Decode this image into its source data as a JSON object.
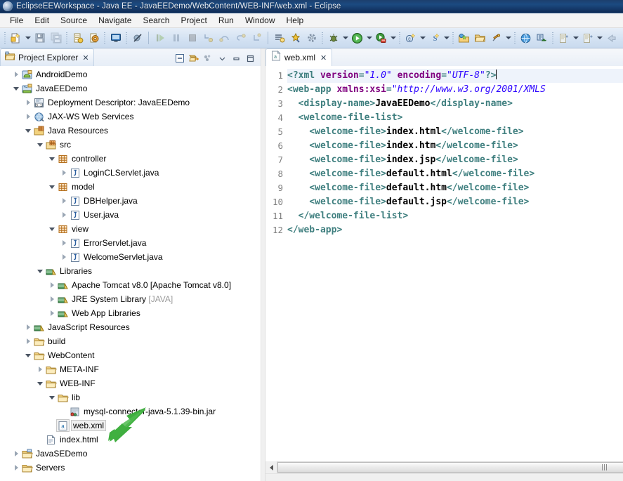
{
  "window": {
    "title": "EclipseEEWorkspace - Java EE - JavaEEDemo/WebContent/WEB-INF/web.xml - Eclipse",
    "app_icon": "eclipse-icon"
  },
  "menubar": {
    "items": [
      "File",
      "Edit",
      "Source",
      "Navigate",
      "Search",
      "Project",
      "Run",
      "Window",
      "Help"
    ]
  },
  "toolbar": {
    "groups": [
      {
        "buttons": [
          {
            "name": "new-wizard-button",
            "icon": "new-file-icon",
            "dropdown": true
          },
          {
            "name": "save-button",
            "icon": "save-icon",
            "dropdown": false
          },
          {
            "name": "save-all-button",
            "icon": "save-all-icon",
            "dropdown": false
          }
        ]
      },
      {
        "buttons": [
          {
            "name": "new-jsp-button",
            "icon": "jsp-file-icon",
            "dropdown": false
          },
          {
            "name": "new-servlet-button",
            "icon": "servlet-icon",
            "dropdown": false
          }
        ]
      },
      {
        "buttons": [
          {
            "name": "console-button",
            "icon": "console-icon",
            "dropdown": false
          }
        ]
      },
      {
        "buttons": [
          {
            "name": "skip-breakpoints-button",
            "icon": "skip-breakpoints-icon",
            "dropdown": false
          }
        ]
      },
      {
        "buttons": [
          {
            "name": "resume-button",
            "icon": "resume-icon",
            "dropdown": false
          },
          {
            "name": "suspend-button",
            "icon": "suspend-icon",
            "dropdown": false
          },
          {
            "name": "terminate-button",
            "icon": "terminate-icon",
            "dropdown": false
          },
          {
            "name": "step-into-button",
            "icon": "step-into-icon",
            "dropdown": false
          },
          {
            "name": "step-over-button",
            "icon": "step-over-icon",
            "dropdown": false
          },
          {
            "name": "step-return-button",
            "icon": "step-return-icon",
            "dropdown": false
          },
          {
            "name": "drop-to-frame-button",
            "icon": "drop-to-frame-icon",
            "dropdown": false
          }
        ]
      },
      {
        "buttons": [
          {
            "name": "open-type-button",
            "icon": "open-type-icon",
            "dropdown": false
          },
          {
            "name": "open-task-button",
            "icon": "open-task-icon",
            "dropdown": false
          },
          {
            "name": "build-all-button",
            "icon": "build-all-icon",
            "dropdown": false
          }
        ]
      },
      {
        "buttons": [
          {
            "name": "debug-button",
            "icon": "debug-icon",
            "dropdown": true
          },
          {
            "name": "run-button",
            "icon": "run-icon",
            "dropdown": true
          },
          {
            "name": "run-as-server-button",
            "icon": "run-server-icon",
            "dropdown": true
          }
        ]
      },
      {
        "buttons": [
          {
            "name": "new-java-class-button",
            "icon": "new-class-icon",
            "dropdown": true
          },
          {
            "name": "new-annotation-button",
            "icon": "new-annotation-icon",
            "dropdown": true
          }
        ]
      },
      {
        "buttons": [
          {
            "name": "open-perspective-button",
            "icon": "open-perspective-icon",
            "dropdown": false
          },
          {
            "name": "open-folder-button",
            "icon": "open-folder-icon",
            "dropdown": false
          },
          {
            "name": "search-button",
            "icon": "pin-icon",
            "dropdown": true
          }
        ]
      },
      {
        "buttons": [
          {
            "name": "web-browser-button",
            "icon": "globe-icon",
            "dropdown": false
          },
          {
            "name": "link-wizard-button",
            "icon": "link-wizard-icon",
            "dropdown": false
          }
        ]
      },
      {
        "buttons": [
          {
            "name": "previous-annotation-button",
            "icon": "prev-annotation-icon",
            "dropdown": true
          },
          {
            "name": "next-annotation-button",
            "icon": "next-annotation-icon",
            "dropdown": true
          },
          {
            "name": "back-button",
            "icon": "back-arrow-icon",
            "dropdown": false
          }
        ]
      }
    ]
  },
  "project_explorer": {
    "tab_label": "Project Explorer",
    "tab_icon": "project-explorer-icon",
    "tab_close": "✕",
    "tools": [
      {
        "name": "collapse-all-button",
        "icon": "collapse-all-icon"
      },
      {
        "name": "link-with-editor-button",
        "icon": "link-editor-icon"
      },
      {
        "name": "view-menu-button",
        "icon": "view-menu-icon"
      },
      {
        "name": "minimize-view-button",
        "icon": "minimize-icon"
      },
      {
        "name": "maximize-view-button",
        "icon": "maximize-icon"
      }
    ],
    "tree": [
      {
        "label": "AndroidDemo",
        "depth": 0,
        "twisty": "collapsed",
        "icon": "android-project-icon",
        "selected": false
      },
      {
        "label": "JavaEEDemo",
        "depth": 0,
        "twisty": "expanded",
        "icon": "javaee-project-icon",
        "selected": false
      },
      {
        "label": "Deployment Descriptor: JavaEEDemo",
        "depth": 1,
        "twisty": "collapsed",
        "icon": "deployment-descriptor-icon",
        "selected": false
      },
      {
        "label": "JAX-WS Web Services",
        "depth": 1,
        "twisty": "collapsed",
        "icon": "web-services-icon",
        "selected": false
      },
      {
        "label": "Java Resources",
        "depth": 1,
        "twisty": "expanded",
        "icon": "java-resources-icon",
        "selected": false
      },
      {
        "label": "src",
        "depth": 2,
        "twisty": "expanded",
        "icon": "source-folder-icon",
        "selected": false
      },
      {
        "label": "controller",
        "depth": 3,
        "twisty": "expanded",
        "icon": "package-icon",
        "selected": false
      },
      {
        "label": "LoginCLServlet.java",
        "depth": 4,
        "twisty": "collapsed",
        "icon": "java-file-icon",
        "selected": false
      },
      {
        "label": "model",
        "depth": 3,
        "twisty": "expanded",
        "icon": "package-icon",
        "selected": false
      },
      {
        "label": "DBHelper.java",
        "depth": 4,
        "twisty": "collapsed",
        "icon": "java-file-icon",
        "selected": false
      },
      {
        "label": "User.java",
        "depth": 4,
        "twisty": "collapsed",
        "icon": "java-file-icon",
        "selected": false
      },
      {
        "label": "view",
        "depth": 3,
        "twisty": "expanded",
        "icon": "package-icon",
        "selected": false
      },
      {
        "label": "ErrorServlet.java",
        "depth": 4,
        "twisty": "collapsed",
        "icon": "java-file-icon",
        "selected": false
      },
      {
        "label": "WelcomeServlet.java",
        "depth": 4,
        "twisty": "collapsed",
        "icon": "java-file-icon",
        "selected": false
      },
      {
        "label": "Libraries",
        "depth": 2,
        "twisty": "expanded",
        "icon": "library-icon",
        "selected": false
      },
      {
        "label": "Apache Tomcat v8.0 [Apache Tomcat v8.0]",
        "depth": 3,
        "twisty": "collapsed",
        "icon": "library-icon",
        "selected": false
      },
      {
        "label": "JRE System Library ",
        "dim": "[JAVA]",
        "depth": 3,
        "twisty": "collapsed",
        "icon": "library-icon",
        "selected": false
      },
      {
        "label": "Web App Libraries",
        "depth": 3,
        "twisty": "collapsed",
        "icon": "library-icon",
        "selected": false
      },
      {
        "label": "JavaScript Resources",
        "depth": 1,
        "twisty": "collapsed",
        "icon": "library-icon",
        "selected": false
      },
      {
        "label": "build",
        "depth": 1,
        "twisty": "collapsed",
        "icon": "folder-icon",
        "selected": false
      },
      {
        "label": "WebContent",
        "depth": 1,
        "twisty": "expanded",
        "icon": "folder-icon",
        "selected": false
      },
      {
        "label": "META-INF",
        "depth": 2,
        "twisty": "collapsed",
        "icon": "folder-icon",
        "selected": false
      },
      {
        "label": "WEB-INF",
        "depth": 2,
        "twisty": "expanded",
        "icon": "folder-icon",
        "selected": false
      },
      {
        "label": "lib",
        "depth": 3,
        "twisty": "expanded",
        "icon": "folder-icon",
        "selected": false
      },
      {
        "label": "mysql-connector-java-5.1.39-bin.jar",
        "depth": 4,
        "twisty": "none",
        "icon": "jar-icon",
        "selected": false
      },
      {
        "label": "web.xml",
        "depth": 3,
        "twisty": "none",
        "icon": "xml-file-icon",
        "selected": true
      },
      {
        "label": "index.html",
        "depth": 2,
        "twisty": "none",
        "icon": "html-file-icon",
        "selected": false
      },
      {
        "label": "JavaSEDemo",
        "depth": 0,
        "twisty": "collapsed",
        "icon": "project-icon",
        "selected": false
      },
      {
        "label": "Servers",
        "depth": 0,
        "twisty": "collapsed",
        "icon": "folder-icon",
        "selected": false
      }
    ]
  },
  "editor": {
    "tab_label": "web.xml",
    "tab_icon": "xml-file-icon",
    "tab_close": "✕",
    "lines": [
      {
        "n": "1",
        "current": true,
        "tokens": [
          {
            "t": "pi",
            "v": "<?xml"
          },
          {
            "t": "plain",
            "v": " "
          },
          {
            "t": "attr",
            "v": "version"
          },
          {
            "t": "pi",
            "v": "="
          },
          {
            "t": "str",
            "v": "\"1.0\""
          },
          {
            "t": "plain",
            "v": " "
          },
          {
            "t": "attr",
            "v": "encoding"
          },
          {
            "t": "pi",
            "v": "="
          },
          {
            "t": "str",
            "v": "\"UTF-8\""
          },
          {
            "t": "pi",
            "v": "?>"
          },
          {
            "t": "caret",
            "v": ""
          }
        ]
      },
      {
        "n": "2",
        "current": false,
        "tokens": [
          {
            "t": "tag",
            "v": "<web-app"
          },
          {
            "t": "plain",
            "v": " "
          },
          {
            "t": "attr",
            "v": "xmlns:xsi"
          },
          {
            "t": "tag",
            "v": "="
          },
          {
            "t": "str",
            "v": "\"http://www.w3.org/2001/XMLS"
          }
        ]
      },
      {
        "n": "3",
        "current": false,
        "tokens": [
          {
            "t": "plain",
            "v": "  "
          },
          {
            "t": "tag",
            "v": "<display-name>"
          },
          {
            "t": "txt",
            "v": "JavaEEDemo"
          },
          {
            "t": "tag",
            "v": "</display-name>"
          }
        ]
      },
      {
        "n": "4",
        "current": false,
        "tokens": [
          {
            "t": "plain",
            "v": "  "
          },
          {
            "t": "tag",
            "v": "<welcome-file-list>"
          }
        ]
      },
      {
        "n": "5",
        "current": false,
        "tokens": [
          {
            "t": "plain",
            "v": "    "
          },
          {
            "t": "tag",
            "v": "<welcome-file>"
          },
          {
            "t": "txt",
            "v": "index.html"
          },
          {
            "t": "tag",
            "v": "</welcome-file>"
          }
        ]
      },
      {
        "n": "6",
        "current": false,
        "tokens": [
          {
            "t": "plain",
            "v": "    "
          },
          {
            "t": "tag",
            "v": "<welcome-file>"
          },
          {
            "t": "txt",
            "v": "index.htm"
          },
          {
            "t": "tag",
            "v": "</welcome-file>"
          }
        ]
      },
      {
        "n": "7",
        "current": false,
        "tokens": [
          {
            "t": "plain",
            "v": "    "
          },
          {
            "t": "tag",
            "v": "<welcome-file>"
          },
          {
            "t": "txt",
            "v": "index.jsp"
          },
          {
            "t": "tag",
            "v": "</welcome-file>"
          }
        ]
      },
      {
        "n": "8",
        "current": false,
        "tokens": [
          {
            "t": "plain",
            "v": "    "
          },
          {
            "t": "tag",
            "v": "<welcome-file>"
          },
          {
            "t": "txt",
            "v": "default.html"
          },
          {
            "t": "tag",
            "v": "</welcome-file>"
          }
        ]
      },
      {
        "n": "9",
        "current": false,
        "tokens": [
          {
            "t": "plain",
            "v": "    "
          },
          {
            "t": "tag",
            "v": "<welcome-file>"
          },
          {
            "t": "txt",
            "v": "default.htm"
          },
          {
            "t": "tag",
            "v": "</welcome-file>"
          }
        ]
      },
      {
        "n": "10",
        "current": false,
        "tokens": [
          {
            "t": "plain",
            "v": "    "
          },
          {
            "t": "tag",
            "v": "<welcome-file>"
          },
          {
            "t": "txt",
            "v": "default.jsp"
          },
          {
            "t": "tag",
            "v": "</welcome-file>"
          }
        ]
      },
      {
        "n": "11",
        "current": false,
        "tokens": [
          {
            "t": "plain",
            "v": "  "
          },
          {
            "t": "tag",
            "v": "</welcome-file-list>"
          }
        ]
      },
      {
        "n": "12",
        "current": false,
        "tokens": [
          {
            "t": "tag",
            "v": "</web-app>"
          }
        ]
      }
    ],
    "hscroll": {
      "name": "editor-horizontal-scrollbar"
    }
  },
  "annotation": {
    "arrow_color": "#3fae3f",
    "name": "green-pointer-arrow"
  },
  "colors": {
    "title_bar": "#15396a",
    "toolbar": "#d5e3f3",
    "tag": "#3f7f7f",
    "attr": "#7f007f",
    "string": "#2a00ff",
    "selection": "#f0f0f0"
  }
}
